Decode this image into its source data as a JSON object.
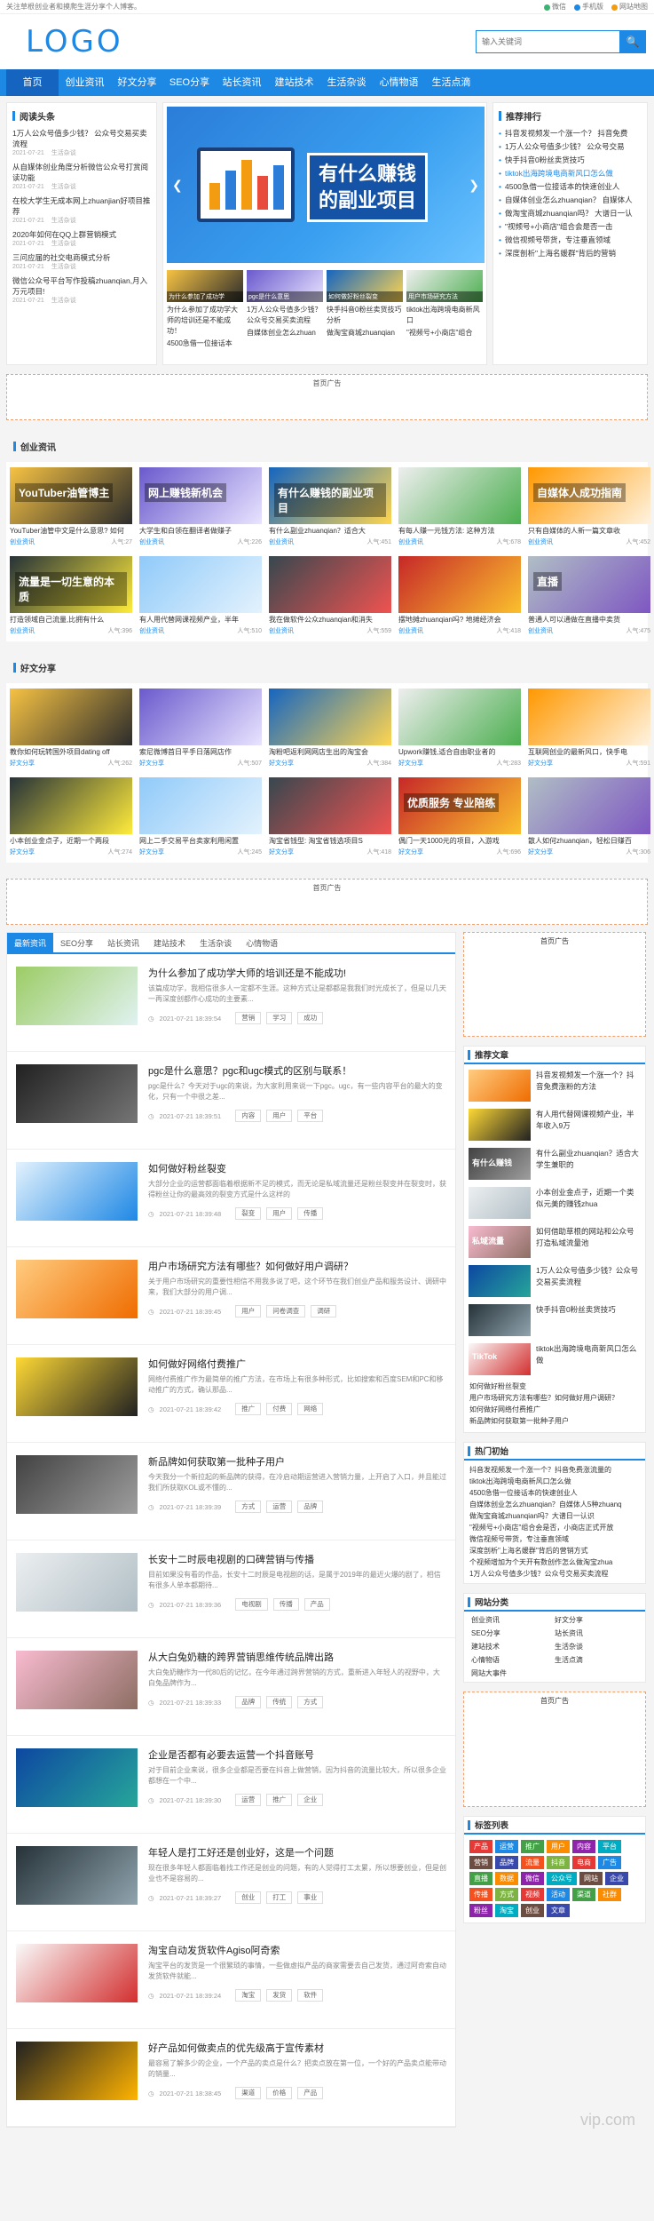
{
  "topbar": {
    "notice": "关注草根创业者和摸爬生涯分享个人博客。",
    "links": [
      "微信",
      "手机版",
      "网站地图"
    ]
  },
  "header": {
    "logo": "LOGO",
    "search_placeholder": "输入关键词"
  },
  "nav": [
    "首页",
    "创业资讯",
    "好文分享",
    "SEO分享",
    "站长资讯",
    "建站技术",
    "生活杂谈",
    "心情物语",
    "生活点滴"
  ],
  "headlines": {
    "title": "阅读头条",
    "items": [
      {
        "t": "1万人公众号值多少钱？ 公众号交易买卖流程",
        "d": "2021-07-21",
        "c": "生活杂谈"
      },
      {
        "t": "从自媒体创业角度分析微信公众号打赏阅读功能",
        "d": "2021-07-21",
        "c": "生活杂谈"
      },
      {
        "t": "在校大学生无成本网上zhuanjian好项目推荐",
        "d": "2021-07-21",
        "c": "生活杂谈"
      },
      {
        "t": "2020年如何在QQ上群营销模式",
        "d": "2021-07-21",
        "c": "生活杂谈"
      },
      {
        "t": "三问应届的社交电商模式分析",
        "d": "2021-07-21",
        "c": "生活杂谈"
      },
      {
        "t": "微信公众号平台写作投稿zhuanqian,月入万元项目!",
        "d": "2021-07-21",
        "c": "生活杂谈"
      }
    ]
  },
  "slider": {
    "line1": "有什么赚钱",
    "line2": "的副业项目",
    "thumbs": [
      {
        "cap": "为什么参加了成功学",
        "t": "为什么参加了成功学大师的培训还是不能成功！"
      },
      {
        "cap": "pgc是什么意思",
        "t": "1万人公众号值多少钱？ 公众号交易买卖流程"
      },
      {
        "cap": "如何做好粉丝裂变",
        "t": "快手抖音0粉丝卖货技巧分析"
      },
      {
        "cap": "用户市场研究方法",
        "t": "tiktok出海跨境电商新风口"
      }
    ],
    "t2": [
      "4500急借一位接话本",
      "自媒体创业怎么zhuan",
      "做淘宝商城zhuanqian",
      "\"视频号+小商店\"组合"
    ]
  },
  "ranking": {
    "title": "推荐排行",
    "items": [
      "抖音发视频发一个涨一个？ 抖音免费",
      "1万人公众号值多少钱？ 公众号交易",
      "快手抖音0粉丝卖货技巧",
      "tiktok出海跨境电商新风口怎么做",
      "4500急借一位接话本的快速创业人",
      "自媒体创业怎么zhuanqian？ 自媒体人",
      "做淘宝商城zhuanqian吗？ 大谱日一认",
      "\"视频号+小商店\"组合会是否一击",
      "微信视频号带货，专注垂直领域",
      "深度剖析\"上海名媛群\"背后的营销"
    ]
  },
  "ad_text": "首页广告",
  "section1": {
    "title": "创业资讯",
    "cards": [
      {
        "label": "YouTuber油管博主",
        "t": "YouTuber油管中文是什么意思? 如何",
        "c": "创业资讯",
        "v": "人气:27"
      },
      {
        "label": "网上赚钱新机会",
        "t": "大学生和白领在翻译者做赚子",
        "c": "创业资讯",
        "v": "人气:226"
      },
      {
        "label": "有什么赚钱的副业项目",
        "t": "有什么副业zhuanqian？适合大",
        "c": "创业资讯",
        "v": "人气:451"
      },
      {
        "label": "",
        "t": "有每人赚一元钱方法: 这种方法",
        "c": "创业资讯",
        "v": "人气:678"
      },
      {
        "label": "自媒体人成功指南",
        "t": "只有自媒体的人新一篇文章收",
        "c": "创业资讯",
        "v": "人气:452"
      },
      {
        "label": "流量是一切生意的本质",
        "t": "打造领域自己流量,比拥有什么",
        "c": "创业资讯",
        "v": "人气:396"
      },
      {
        "label": "",
        "t": "有人用代替网课视频产业，半年",
        "c": "创业资讯",
        "v": "人气:510"
      },
      {
        "label": "",
        "t": "我在做软件公众zhuanqian和消失",
        "c": "创业资讯",
        "v": "人气:559"
      },
      {
        "label": "",
        "t": "摆地摊zhuanqian吗? 地摊经济会",
        "c": "创业资讯",
        "v": "人气:418"
      },
      {
        "label": "直播",
        "t": "普通人可以通做在直播中卖货",
        "c": "创业资讯",
        "v": "人气:475"
      }
    ]
  },
  "section2": {
    "title": "好文分享",
    "cards": [
      {
        "label": "",
        "t": "教你如何玩转国外项目dating off",
        "c": "好文分享",
        "v": "人气:262"
      },
      {
        "label": "",
        "t": "索尼微博首日平手日落网店作",
        "c": "好文分享",
        "v": "人气:507"
      },
      {
        "label": "",
        "t": "淘粉吧返利网网店生出的淘宝会",
        "c": "好文分享",
        "v": "人气:384"
      },
      {
        "label": "",
        "t": "Upwork赚钱,适合自由职业者的",
        "c": "好文分享",
        "v": "人气:283"
      },
      {
        "label": "",
        "t": "互联网创业的最新风口，快手电",
        "c": "好文分享",
        "v": "人气:591"
      },
      {
        "label": "",
        "t": "小本创业金点子，近期一个两段",
        "c": "好文分享",
        "v": "人气:274"
      },
      {
        "label": "",
        "t": "网上二手交易平台卖家利用闲置",
        "c": "好文分享",
        "v": "人气:245"
      },
      {
        "label": "",
        "t": "淘宝省钱型: 淘宝省钱选项目S",
        "c": "好文分享",
        "v": "人气:418"
      },
      {
        "label": "优质服务 专业陪练",
        "t": "偶门一天1000元的项目，入游戏",
        "c": "好文分享",
        "v": "人气:696"
      },
      {
        "label": "",
        "t": "散人如何zhuanqian，轻松日赚百",
        "c": "好文分享",
        "v": "人气:306"
      }
    ]
  },
  "tabs": [
    "最新资讯",
    "SEO分享",
    "站长资讯",
    "建站技术",
    "生活杂谈",
    "心情物语"
  ],
  "posts": [
    {
      "t": "为什么参加了成功学大师的培训还是不能成功!",
      "d": "该篇成功学，我相信很多人一定都不生涯。这种方式让是都都是我我们时光成长了，但是以几天一再深度创都作心成功的主要素...",
      "time": "2021-07-21 18:39:54",
      "tags": [
        "营销",
        "学习",
        "成功"
      ]
    },
    {
      "t": "pgc是什么意思？pgc和ugc模式的区别与联系！",
      "d": "pgc是什么？今天对于ugc的来说，为大家利用来说一下pgc。ugc，有一些内容平台的最大的变化，只有一个中很之差...",
      "time": "2021-07-21 18:39:51",
      "tags": [
        "内容",
        "用户",
        "平台"
      ]
    },
    {
      "t": "如何做好粉丝裂变",
      "d": "大部分企业的运营都面临着根据新不足的模式，而无论是私域流量还是粉丝裂变并在裂变时，获得粉丝让你的最高效的裂变方式是什么这样的",
      "time": "2021-07-21 18:39:48",
      "tags": [
        "裂变",
        "用户",
        "传播"
      ]
    },
    {
      "t": "用户市场研究方法有哪些？如何做好用户调研？",
      "d": "关于用户市场研究的重要性相信不用我多说了吧，这个环节在我们创业产品和服务设计、调研中来，我们大部分的用户调...",
      "time": "2021-07-21 18:39:45",
      "tags": [
        "用户",
        "问卷调查",
        "调研"
      ]
    },
    {
      "t": "如何做好网络付费推广",
      "d": "网络付费推广作为最简单的推广方法，在市场上有很多种形式，比如搜索和百度SEM和PC和移动推广的方式，确认那品...",
      "time": "2021-07-21 18:39:42",
      "tags": [
        "推广",
        "付费",
        "网络"
      ]
    },
    {
      "t": "新品牌如何获取第一批种子用户",
      "d": "今天我分一个新拉起的新品牌的获得，在冷启动期运营进入营销力量，上开启了入口，并且能过我们所获取KOL或不懂的...",
      "time": "2021-07-21 18:39:39",
      "tags": [
        "方式",
        "运营",
        "品牌"
      ]
    },
    {
      "t": "长安十二时辰电视剧的口碑营销与传播",
      "d": "目前如果没有看的作品，长安十二时辰是电视剧的话，是属于2019年的最近火爆的剧了，相信有很多人单本都期待...",
      "time": "2021-07-21 18:39:36",
      "tags": [
        "电视剧",
        "传播",
        "产品"
      ]
    },
    {
      "t": "从大白兔奶糖的跨界营销思维传统品牌出路",
      "d": "大白兔奶糖作为一代80后的记忆，在今年通过跨界营销的方式，重新进入年轻人的视野中，大白兔品牌作为...",
      "time": "2021-07-21 18:39:33",
      "tags": [
        "品牌",
        "传统",
        "方式"
      ]
    },
    {
      "t": "企业是否都有必要去运营一个抖音账号",
      "d": "对于目前企业来说，很多企业都是否要在抖音上做营销，因为抖音的流量比较大，所以很多企业都想在一个中...",
      "time": "2021-07-21 18:39:30",
      "tags": [
        "运营",
        "推广",
        "企业"
      ]
    },
    {
      "t": "年轻人是打工好还是创业好，这是一个问题",
      "d": "现在很多年轻人都面临着找工作还是创业的问题，有的人觉得打工太累，所以想要创业，但是创业也不是容易的...",
      "time": "2021-07-21 18:39:27",
      "tags": [
        "创业",
        "打工",
        "事业"
      ]
    },
    {
      "t": "淘宝自动发货软件Agiso阿奇索",
      "d": "淘宝平台的发货是一个很繁琐的事情，一些做虚拟产品的商家需要去自己发货，通过阿奇索自动发货软件就能...",
      "time": "2021-07-21 18:39:24",
      "tags": [
        "淘宝",
        "发货",
        "软件"
      ]
    },
    {
      "t": "好产品如何做卖点的优先级高于宣传素材",
      "d": "最容易了解多少的企业，一个产品的卖点是什么？把卖点放在第一位，一个好的产品卖点能带动的销量...",
      "time": "2021-07-21 18:38:45",
      "tags": [
        "渠道",
        "价格",
        "产品"
      ]
    }
  ],
  "sidebar": {
    "ad_text": "首页广告",
    "rec_title": "推荐文章",
    "rec_items": [
      {
        "t": "抖音发视频发一个涨一个？抖音免费涨粉的方法",
        "label": ""
      },
      {
        "t": "有人用代替网课视频产业，半年收入9万",
        "label": ""
      },
      {
        "t": "有什么副业zhuanqian？适合大学生兼职的",
        "label": "有什么赚钱"
      },
      {
        "t": "小本创业金点子，近期一个类似元美的赚钱zhua",
        "label": ""
      },
      {
        "t": "如何借助草根的网站和公众号打造私域流量池",
        "label": "私域流量"
      },
      {
        "t": "1万人公众号值多少钱？公众号交易买卖流程",
        "label": ""
      },
      {
        "t": "快手抖音0粉丝卖货技巧",
        "label": ""
      },
      {
        "t": "tiktok出海跨境电商新风口怎么做",
        "label": "TikTok"
      }
    ],
    "rec_text": [
      "如何做好粉丝裂变",
      "用户市场研究方法有哪些？如何做好用户调研？",
      "如何做好网络付费推广",
      "新品牌如何获取第一批种子用户"
    ],
    "hot_title": "热门初始",
    "hot_items": [
      "抖音发视频发一个涨一个？抖音免费涨流量的",
      "tiktok出海跨境电商新风口怎么做",
      "4500急借一位接话本的快速创业人",
      "自媒体创业怎么zhuanqian？自媒体人5种zhuanq",
      "做淘宝商城zhuanqian吗？大谱日一认识",
      "\"视频号+小商店\"组合会是否，小商店正式开放",
      "微信视频号带货，专注垂直领域",
      "深度剖析\"上海名媛群\"背后的营销方式",
      "个视频增加为个天开有数创作怎么做淘宝zhua",
      "1万人公众号值多少钱？公众号交易买卖流程"
    ],
    "cat_title": "网站分类",
    "cats": [
      "创业资讯",
      "好文分享",
      "SEO分享",
      "站长资讯",
      "建站技术",
      "生活杂谈",
      "心情物语",
      "生活点滴",
      "网站大事件"
    ],
    "ad2_text": "首页广告",
    "tag_title": "标签列表",
    "tags": [
      "产品",
      "运营",
      "推广",
      "用户",
      "内容",
      "平台",
      "营销",
      "品牌",
      "流量",
      "抖音",
      "电商",
      "广告",
      "直播",
      "数据",
      "微信",
      "公众号",
      "网站",
      "企业",
      "传播",
      "方式",
      "视频",
      "活动",
      "渠道",
      "社群",
      "粉丝",
      "淘宝",
      "创业",
      "文章"
    ]
  },
  "watermark": "vip.com"
}
